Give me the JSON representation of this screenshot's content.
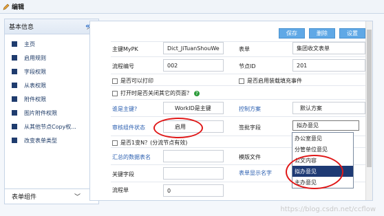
{
  "window": {
    "title": "编辑"
  },
  "sidebar": {
    "header": "基本信息",
    "items": [
      {
        "label": "主页"
      },
      {
        "label": "启用规则"
      },
      {
        "label": "字段权限"
      },
      {
        "label": "从表权限"
      },
      {
        "label": "附件权限"
      },
      {
        "label": "图片附件权限"
      },
      {
        "label": "从其他节点Copy权..."
      },
      {
        "label": "改变表单类型"
      }
    ],
    "footer": "表单组件"
  },
  "toolbar": {
    "save": "保存",
    "delete": "删除",
    "settings": "设置"
  },
  "form": {
    "main_key_label": "主键MyPK",
    "main_key_value": "Dict_JiTuanShouWe",
    "form_label": "表单",
    "form_value": "集团收文表单",
    "flow_no_label": "流程编号",
    "flow_no_value": "002",
    "node_id_label": "节点ID",
    "node_id_value": "201",
    "can_print": "是否可以打印",
    "enable_load_fill": "是否启用装载填充事件",
    "open_flag": "打开时是否关闭其它的页面？",
    "primary_key_q": "谁是主键?",
    "primary_key_value": "WorkID是主键",
    "control_scheme": "控制方案",
    "control_scheme_value": "默认方案",
    "audit_state_label": "审核组件状态",
    "audit_state_value": "启用",
    "sign_field": "签批字段",
    "sign_field_value": "拟办意见",
    "one_to_n": "是否1变N？(分流节点有效)",
    "summary_table": "汇总的数据表名",
    "template_file": "模版文件",
    "key_field": "关键字段",
    "form_display_name": "表单显示名字",
    "partial_label": "流程单",
    "partial_value": "0"
  },
  "dropdown": {
    "options": [
      "办公室意见",
      "分管单位意见",
      "公文内容",
      "拟办意见",
      "主办意见"
    ],
    "selected": "拟办意见"
  },
  "watermark": "https://blog.csdn.net/ccflow"
}
